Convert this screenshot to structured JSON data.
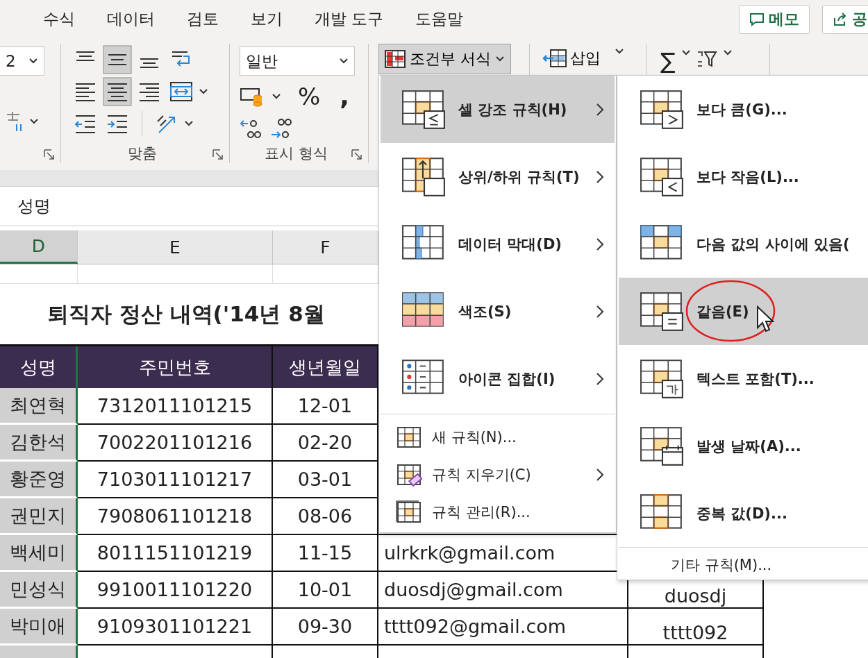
{
  "ribbon_tabs": [
    "수식",
    "데이터",
    "검토",
    "보기",
    "개발 도구",
    "도움말"
  ],
  "memo_button": "메모",
  "share_button": "공",
  "font_size": "2",
  "align_rows": [
    [
      {
        "kind": "top",
        "selected": false
      },
      {
        "kind": "middle",
        "selected": true
      },
      {
        "kind": "bottom",
        "selected": false
      },
      {
        "kind": "wrap",
        "selected": false
      }
    ],
    [
      {
        "kind": "left",
        "selected": false
      },
      {
        "kind": "center",
        "selected": true
      },
      {
        "kind": "right",
        "selected": false
      },
      {
        "kind": "merge",
        "selected": false
      }
    ],
    [
      {
        "kind": "outdent",
        "selected": false
      },
      {
        "kind": "indent",
        "selected": false
      },
      {
        "kind": "orient",
        "selected": false
      }
    ]
  ],
  "number_format": "일반",
  "percent": "%",
  "comma": ",",
  "group_labels": [
    "맞춤",
    "표시 형식"
  ],
  "conditional_format_button": {
    "label": "조건부 서식",
    "pressed": true
  },
  "insert_button": "삽입",
  "autosum": "∑",
  "formula_bar": "성명",
  "columns": [
    {
      "label": "D",
      "selected": true
    },
    {
      "label": "E",
      "selected": false
    },
    {
      "label": "F",
      "selected": false
    }
  ],
  "sheet_title": "퇴직자 정산 내역('14년 8월",
  "table_headers": [
    "성명",
    "주민번호",
    "생년월일"
  ],
  "rows": [
    {
      "name": "최연혁",
      "id": "7312011101215",
      "birth": "12-01"
    },
    {
      "name": "김한석",
      "id": "7002201101216",
      "birth": "02-20"
    },
    {
      "name": "황준영",
      "id": "7103011101217",
      "birth": "03-01"
    },
    {
      "name": "권민지",
      "id": "7908061101218",
      "birth": "08-06"
    },
    {
      "name": "백세미",
      "id": "8011151101219",
      "birth": "11-15",
      "email": "ulrkrk@gmail.com"
    },
    {
      "name": "민성식",
      "id": "9910011101220",
      "birth": "10-01",
      "email": "duosdj@gmail.com",
      "user": "duosdj"
    },
    {
      "name": "박미애",
      "id": "9109301101221",
      "birth": "09-30",
      "email": "tttt092@gmail.com",
      "user": "tttt092"
    }
  ],
  "cf_menu": [
    {
      "kind": "highlight",
      "label": "셀 강조 규칙(H)",
      "submenu": true,
      "selected": true
    },
    {
      "kind": "topbottom",
      "label": "상위/하위 규칙(T)",
      "submenu": true,
      "selected": false
    },
    {
      "kind": "databar",
      "label": "데이터 막대(D)",
      "submenu": true,
      "selected": false
    },
    {
      "kind": "colorscale",
      "label": "색조(S)",
      "submenu": true,
      "selected": false
    },
    {
      "kind": "iconset",
      "label": "아이콘 집합(I)",
      "submenu": true,
      "selected": false
    },
    {
      "kind": "newrule",
      "label": "새 규칙(N)...",
      "submenu": false,
      "selected": false
    },
    {
      "kind": "clear",
      "label": "규칙 지우기(C)",
      "submenu": true,
      "selected": false
    },
    {
      "kind": "manage",
      "label": "규칙 관리(R)...",
      "submenu": false,
      "selected": false
    }
  ],
  "cf_submenu": [
    {
      "kind": "greater",
      "label": "보다 큼(G)...",
      "selected": false
    },
    {
      "kind": "less",
      "label": "보다 작음(L)...",
      "selected": false
    },
    {
      "kind": "between",
      "label": "다음 값의 사이에 있음(",
      "selected": false
    },
    {
      "kind": "equal",
      "label": "같음(E)",
      "selected": true
    },
    {
      "kind": "text",
      "label": "텍스트 포함(T)...",
      "selected": false
    },
    {
      "kind": "date",
      "label": "발생 날짜(A)...",
      "selected": false
    },
    {
      "kind": "duplicate",
      "label": "중복 값(D)...",
      "selected": false
    },
    {
      "kind": "more",
      "label": "기타 규칙(M)...",
      "selected": false
    }
  ]
}
